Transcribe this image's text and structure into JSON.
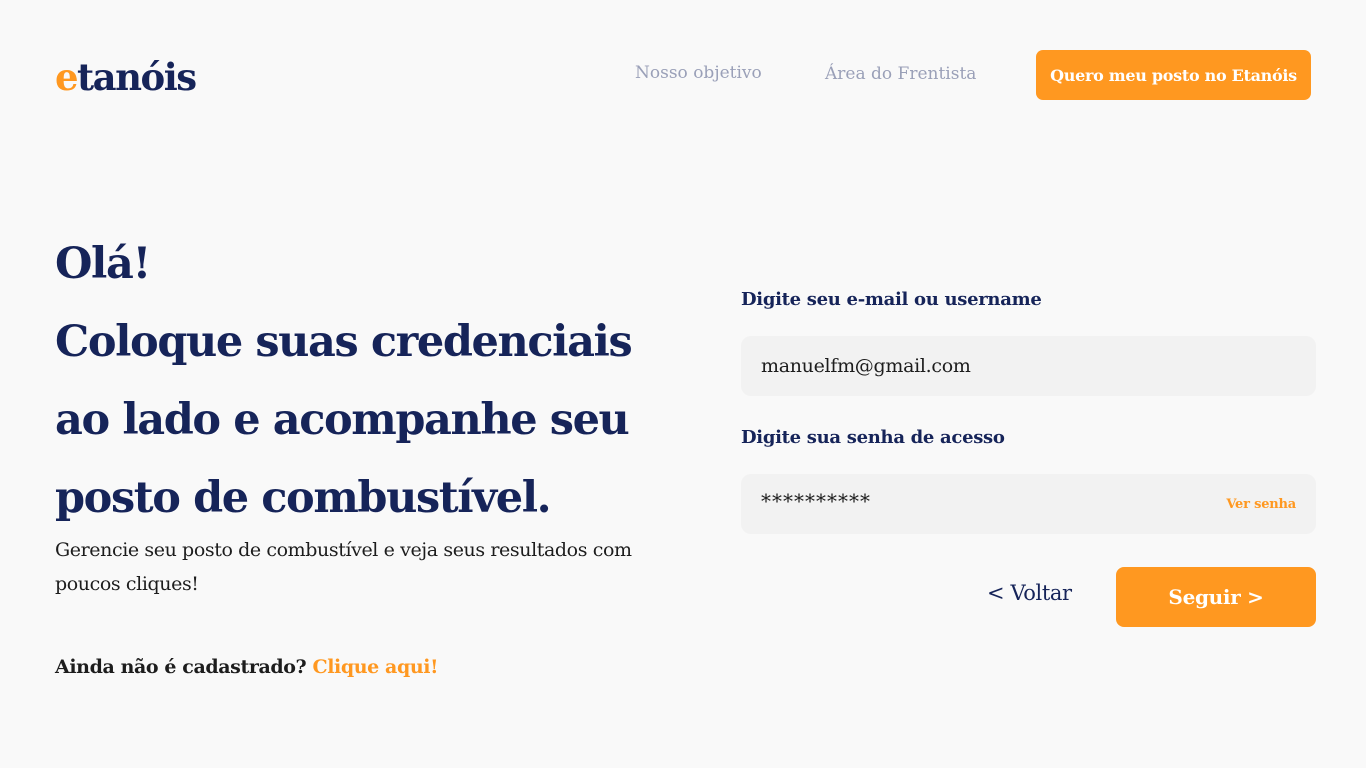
{
  "header": {
    "logo_accent": "e",
    "logo_rest": "tanóis",
    "nav": [
      "Nosso objetivo",
      "Área do Frentista"
    ],
    "cta_label": "Quero meu posto no Etanóis"
  },
  "hero": {
    "title_lines": [
      "Olá!",
      "Coloque suas credenciais",
      "ao lado e acompanhe seu",
      "posto de combustível."
    ],
    "subtitle": "Gerencie seu posto de combustível e veja seus resultados com poucos cliques!",
    "signup_prompt": "Ainda não é cadastrado?",
    "signup_link": "Clique aqui!"
  },
  "form": {
    "email_label": "Digite seu e-mail ou username",
    "email_value": "manuelfm@gmail.com",
    "password_label": "Digite sua senha de acesso",
    "password_masked": "**********",
    "show_password": "Ver senha",
    "back_label": "< Voltar",
    "next_label": "Seguir >"
  },
  "colors": {
    "brand_navy": "#162459",
    "accent_orange": "#ff9820",
    "nav_gray": "#9aa0b8",
    "background": "#f9f9f9",
    "field_bg": "#f2f2f2"
  }
}
